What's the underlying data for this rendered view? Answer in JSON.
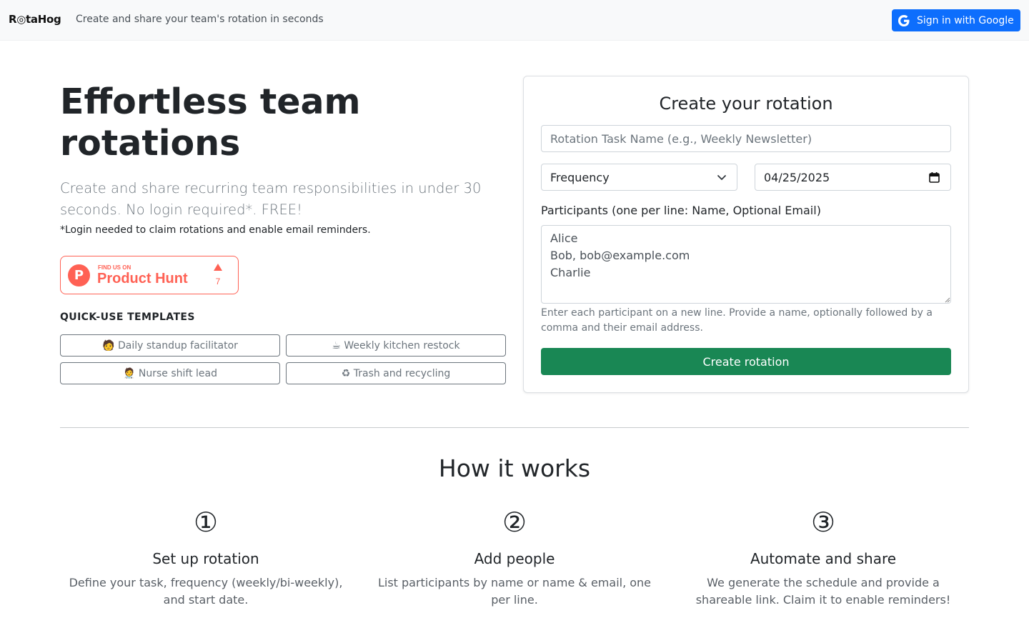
{
  "navbar": {
    "brand": "R◎taHog",
    "tagline": "Create and share your team's rotation in seconds",
    "signin_label": "Sign in with Google"
  },
  "hero": {
    "title": "Effortless team rotations",
    "lead": "Create and share recurring team responsibilities in under 30 seconds. No login required*. FREE!",
    "note": "*Login needed to claim rotations and enable email reminders."
  },
  "product_hunt": {
    "small_text": "FIND US ON",
    "name": "Product Hunt",
    "upvotes": "7",
    "brand_color": "#ff6154"
  },
  "templates": {
    "heading": "QUICK-USE TEMPLATES",
    "items": [
      {
        "label": "🧑 Daily standup facilitator"
      },
      {
        "label": "☕ Weekly kitchen restock"
      },
      {
        "label": "🧑‍⚕ Nurse shift lead"
      },
      {
        "label": "♻ Trash and recycling"
      }
    ]
  },
  "form": {
    "title": "Create your rotation",
    "task_placeholder": "Rotation Task Name (e.g., Weekly Newsletter)",
    "frequency_value": "Frequency",
    "start_date_value": "04/25/2025",
    "participants_label": "Participants (one per line: Name, Optional Email)",
    "participants_value": "Alice\nBob, bob@example.com\nCharlie",
    "help_text": "Enter each participant on a new line. Provide a name, optionally followed by a comma and their email address.",
    "submit_label": "Create rotation",
    "submit_color": "#198754"
  },
  "how_it_works": {
    "title": "How it works",
    "steps": [
      {
        "number": "①",
        "title": "Set up rotation",
        "description": "Define your task, frequency (weekly/bi-weekly), and start date."
      },
      {
        "number": "②",
        "title": "Add people",
        "description": "List participants by name or name & email, one per line."
      },
      {
        "number": "③",
        "title": "Automate and share",
        "description": "We generate the schedule and provide a shareable link. Claim it to enable reminders!"
      }
    ]
  },
  "colors": {
    "primary": "#0d6efd",
    "muted": "#6c757d"
  }
}
